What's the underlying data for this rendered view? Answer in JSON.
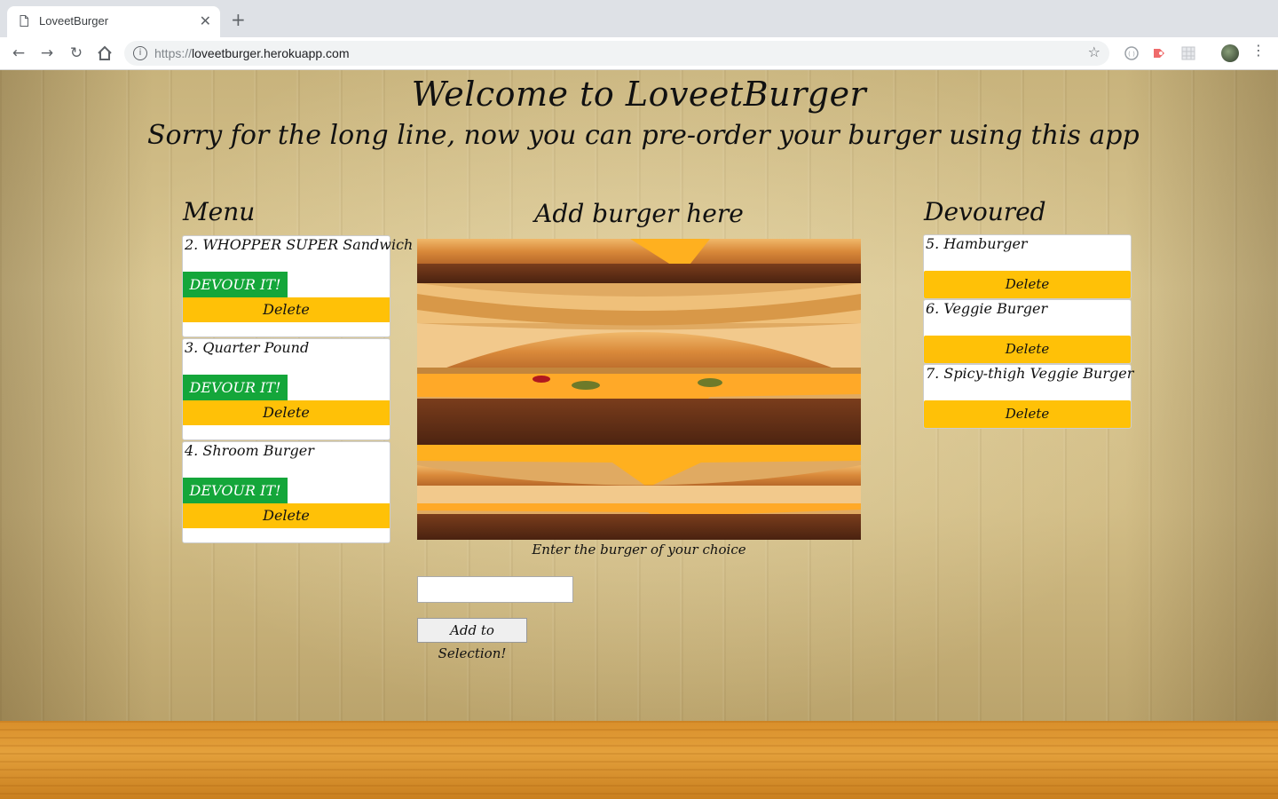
{
  "browser": {
    "tab_title": "LoveetBurger",
    "tab_close": "✕",
    "new_tab": "+",
    "url_scheme": "https://",
    "url_host": "loveetburger.herokuapp.com"
  },
  "header": {
    "title": "Welcome to LoveetBurger",
    "subtitle": "Sorry for the long line, now you can pre-order your burger using this app"
  },
  "menu": {
    "heading": "Menu",
    "devour_label": "DEVOUR IT!",
    "delete_label": "Delete",
    "items": [
      {
        "name": "2. WHOPPER SUPER Sandwich"
      },
      {
        "name": "3. Quarter Pound"
      },
      {
        "name": "4. Shroom Burger"
      }
    ]
  },
  "add": {
    "heading": "Add burger here",
    "prompt": "Enter the burger of your choice",
    "input_value": "",
    "button_label": "Add to Selection!"
  },
  "devoured": {
    "heading": "Devoured",
    "delete_label": "Delete",
    "items": [
      {
        "name": "5. Hamburger"
      },
      {
        "name": "6. Veggie Burger"
      },
      {
        "name": "7. Spicy-thigh Veggie Burger"
      }
    ]
  },
  "colors": {
    "devour_green": "#14a63a",
    "delete_yellow": "#ffc107"
  }
}
